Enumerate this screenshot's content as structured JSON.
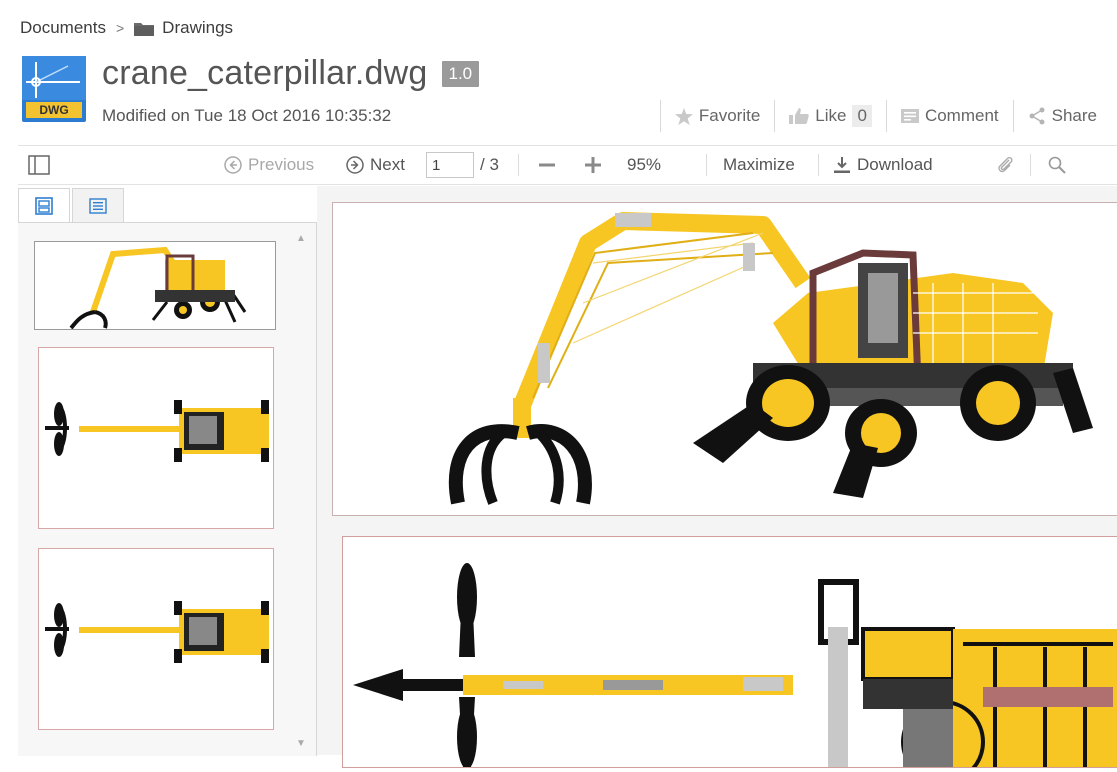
{
  "breadcrumb": {
    "root": "Documents",
    "separator": ">",
    "folder": "Drawings"
  },
  "file": {
    "type_badge": "DWG",
    "name": "crane_caterpillar.dwg",
    "version": "1.0",
    "modified": "Modified on Tue 18 Oct 2016 10:35:32"
  },
  "actions": {
    "favorite": "Favorite",
    "like": "Like",
    "like_count": "0",
    "comment": "Comment",
    "share": "Share"
  },
  "toolbar": {
    "previous": "Previous",
    "next": "Next",
    "current_page": "1",
    "total_pages": "/ 3",
    "zoom": "95%",
    "maximize": "Maximize",
    "download": "Download"
  },
  "icons": {
    "sidebar_toggle": "sidebar-toggle-icon",
    "thumbnails_tab": "thumbnails-icon",
    "outline_tab": "outline-icon",
    "zoom_out": "minus-icon",
    "zoom_in": "plus-icon",
    "attachment": "paperclip-icon",
    "search": "search-icon"
  },
  "colors": {
    "crane_yellow": "#f7c623",
    "accent_blue": "#2f7fd0",
    "dwg_badge": "#f2c230"
  }
}
